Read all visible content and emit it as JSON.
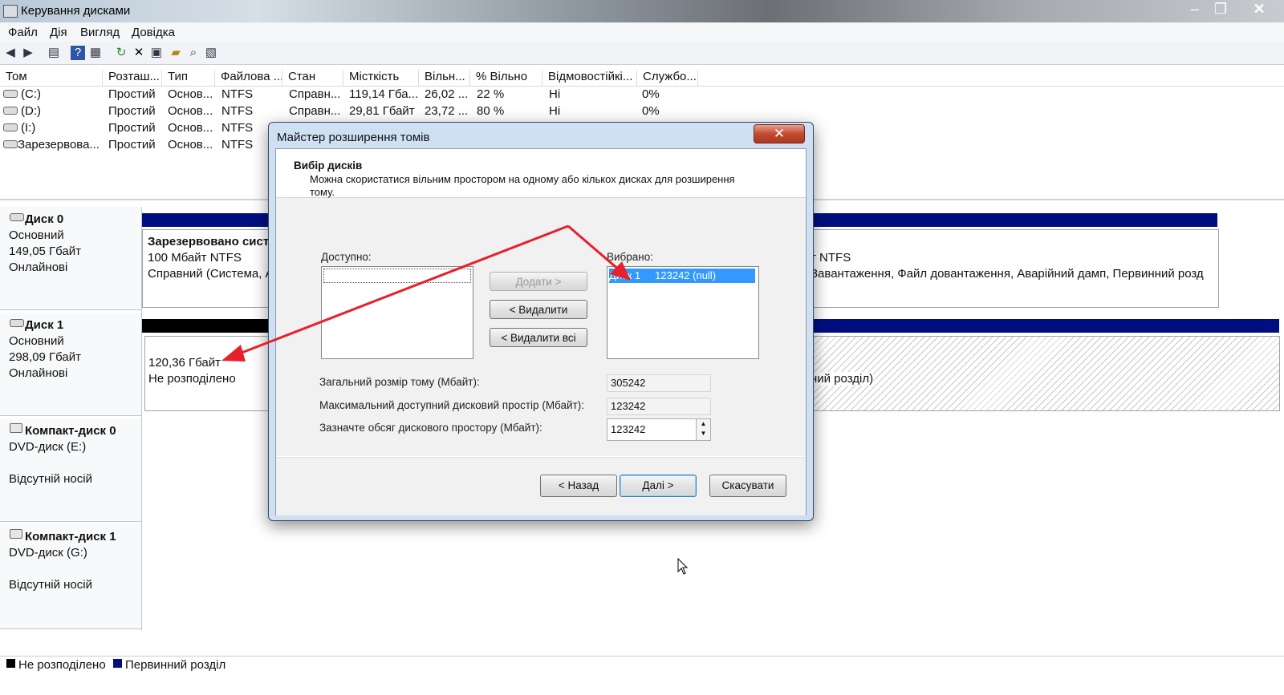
{
  "window": {
    "title": "Керування дисками",
    "minimize_glyph": "–",
    "maximize_glyph": "❐",
    "close_glyph": "✕"
  },
  "menu": {
    "items": [
      "Файл",
      "Дія",
      "Вигляд",
      "Довідка"
    ]
  },
  "toolbar": {
    "icons": [
      "back-icon",
      "forward-icon",
      "properties-icon",
      "help-icon",
      "view-icon",
      "refresh-icon",
      "delete-icon",
      "open-icon",
      "explore-icon",
      "search-icon",
      "properties-2-icon"
    ]
  },
  "volume_list": {
    "headers": [
      "Том",
      "Розташ...",
      "Тип",
      "Файлова ...",
      "Стан",
      "Місткість",
      "Вільн...",
      "% Вільно",
      "Відмовостійкі...",
      "Службо..."
    ],
    "rows": [
      [
        "(C:)",
        "Простий",
        "Основ...",
        "NTFS",
        "Справн...",
        "119,14 Гба...",
        "26,02 ...",
        "22 %",
        "Ні",
        "0%"
      ],
      [
        "(D:)",
        "Простий",
        "Основ...",
        "NTFS",
        "Справн...",
        "29,81 Гбайт",
        "23,72 ...",
        "80 %",
        "Ні",
        "0%"
      ],
      [
        "(I:)",
        "Простий",
        "Основ...",
        "NTFS",
        "",
        "",
        "",
        "",
        "",
        ""
      ],
      [
        "Зарезервова...",
        "Простий",
        "Основ...",
        "NTFS",
        "",
        "",
        "",
        "",
        "",
        ""
      ]
    ]
  },
  "disks": [
    {
      "name": "Диск 0",
      "type": "Основний",
      "size": "149,05 Гбайт",
      "status": "Онлайнові",
      "part1": {
        "title": "Зарезервовано систе",
        "line2": "100 Мбайт NTFS",
        "line3": "Справний (Система, А"
      },
      "part2": {
        "line2": "т NTFS",
        "line3": "Завантаження, Файл довантаження, Аварійний дамп, Первинний розд"
      }
    },
    {
      "name": "Диск 1",
      "type": "Основний",
      "size": "298,09 Гбайт",
      "status": "Онлайнові",
      "part1": {
        "line2": "120,36 Гбайт",
        "line3": "Не розподілено"
      },
      "part2": {
        "line3": "ний розділ)"
      }
    },
    {
      "name": "Компакт-диск 0",
      "type": "DVD-диск (E:)",
      "status": "Відсутній носій"
    },
    {
      "name": "Компакт-диск 1",
      "type": "DVD-диск (G:)",
      "status": "Відсутній носій"
    }
  ],
  "legend": {
    "unallocated": "Не розподілено",
    "primary": "Первинний розділ"
  },
  "dialog": {
    "title": "Майстер розширення томів",
    "close_glyph": "✕",
    "heading": "Вибір дисків",
    "description": "Можна скористатися вільним простором на одному або кількох дисках для розширення тому.",
    "available_label": "Доступно:",
    "selected_label": "Вибрано:",
    "selected_item": "Диск 1     123242 (null)",
    "add_button": "Додати >",
    "remove_button": "< Видалити",
    "remove_all_button": "< Видалити всі",
    "total_size_label": "Загальний розмір тому (Мбайт):",
    "total_size_value": "305242",
    "max_space_label": "Максимальний доступний дисковий простір (Мбайт):",
    "max_space_value": "123242",
    "specify_label": "Зазначте обсяг дискового простору (Мбайт):",
    "specify_value": "123242",
    "back_button": "< Назад",
    "next_button": "Далі >",
    "cancel_button": "Скасувати"
  },
  "colors": {
    "primary_partition": "#000f80",
    "unallocated": "#000000",
    "annotation_arrow": "#e8202a",
    "selection": "#3399ff"
  }
}
